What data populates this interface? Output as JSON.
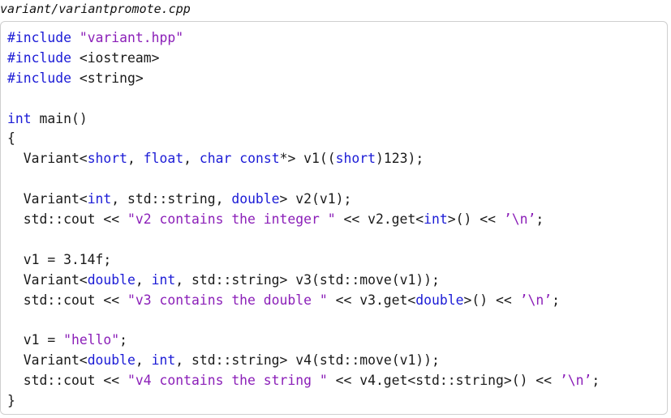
{
  "file": {
    "name": "variant/variantpromote.cpp"
  },
  "code": {
    "lines": [
      [
        {
          "t": "kw",
          "v": "#include"
        },
        {
          "t": "pl",
          "v": " "
        },
        {
          "t": "str",
          "v": "\"variant.hpp\""
        }
      ],
      [
        {
          "t": "kw",
          "v": "#include"
        },
        {
          "t": "pl",
          "v": " <iostream>"
        }
      ],
      [
        {
          "t": "kw",
          "v": "#include"
        },
        {
          "t": "pl",
          "v": " <string>"
        }
      ],
      [],
      [
        {
          "t": "kw",
          "v": "int"
        },
        {
          "t": "pl",
          "v": " main()"
        }
      ],
      [
        {
          "t": "pl",
          "v": "{"
        }
      ],
      [
        {
          "t": "pl",
          "v": "  Variant<"
        },
        {
          "t": "kw",
          "v": "short"
        },
        {
          "t": "pl",
          "v": ", "
        },
        {
          "t": "kw",
          "v": "float"
        },
        {
          "t": "pl",
          "v": ", "
        },
        {
          "t": "kw",
          "v": "char"
        },
        {
          "t": "pl",
          "v": " "
        },
        {
          "t": "kw",
          "v": "const"
        },
        {
          "t": "pl",
          "v": "*> v1(("
        },
        {
          "t": "kw",
          "v": "short"
        },
        {
          "t": "pl",
          "v": ")123);"
        }
      ],
      [],
      [
        {
          "t": "pl",
          "v": "  Variant<"
        },
        {
          "t": "kw",
          "v": "int"
        },
        {
          "t": "pl",
          "v": ", std::string, "
        },
        {
          "t": "kw",
          "v": "double"
        },
        {
          "t": "pl",
          "v": "> v2(v1);"
        }
      ],
      [
        {
          "t": "pl",
          "v": "  std::cout << "
        },
        {
          "t": "str",
          "v": "\"v2 contains the integer \""
        },
        {
          "t": "pl",
          "v": " << v2.get<"
        },
        {
          "t": "kw",
          "v": "int"
        },
        {
          "t": "pl",
          "v": ">() << "
        },
        {
          "t": "str",
          "v": "’\\n’"
        },
        {
          "t": "pl",
          "v": ";"
        }
      ],
      [],
      [
        {
          "t": "pl",
          "v": "  v1 = 3.14f;"
        }
      ],
      [
        {
          "t": "pl",
          "v": "  Variant<"
        },
        {
          "t": "kw",
          "v": "double"
        },
        {
          "t": "pl",
          "v": ", "
        },
        {
          "t": "kw",
          "v": "int"
        },
        {
          "t": "pl",
          "v": ", std::string> v3(std::move(v1));"
        }
      ],
      [
        {
          "t": "pl",
          "v": "  std::cout << "
        },
        {
          "t": "str",
          "v": "\"v3 contains the double \""
        },
        {
          "t": "pl",
          "v": " << v3.get<"
        },
        {
          "t": "kw",
          "v": "double"
        },
        {
          "t": "pl",
          "v": ">() << "
        },
        {
          "t": "str",
          "v": "’\\n’"
        },
        {
          "t": "pl",
          "v": ";"
        }
      ],
      [],
      [
        {
          "t": "pl",
          "v": "  v1 = "
        },
        {
          "t": "str",
          "v": "\"hello\""
        },
        {
          "t": "pl",
          "v": ";"
        }
      ],
      [
        {
          "t": "pl",
          "v": "  Variant<"
        },
        {
          "t": "kw",
          "v": "double"
        },
        {
          "t": "pl",
          "v": ", "
        },
        {
          "t": "kw",
          "v": "int"
        },
        {
          "t": "pl",
          "v": ", std::string> v4(std::move(v1));"
        }
      ],
      [
        {
          "t": "pl",
          "v": "  std::cout << "
        },
        {
          "t": "str",
          "v": "\"v4 contains the string \""
        },
        {
          "t": "pl",
          "v": " << v4.get<std::string>() << "
        },
        {
          "t": "str",
          "v": "’\\n’"
        },
        {
          "t": "pl",
          "v": ";"
        }
      ],
      [
        {
          "t": "pl",
          "v": "}"
        }
      ]
    ]
  }
}
